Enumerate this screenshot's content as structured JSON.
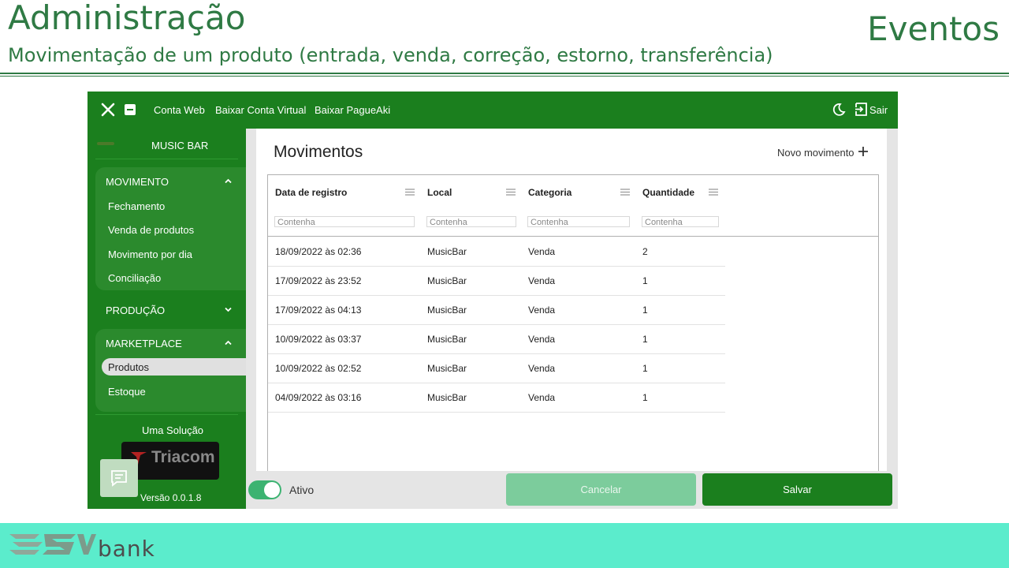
{
  "slide": {
    "title": "Administração",
    "subtitle": "Movimentação de um produto (entrada, venda, correção, estorno, transferência)",
    "tag": "Eventos"
  },
  "topbar": {
    "nav": [
      "Conta Web",
      "Baixar Conta Virtual",
      "Baixar PagueAki"
    ],
    "exit_label": "Sair",
    "color": "#1b7f1e"
  },
  "sidebar": {
    "brand": "MUSIC BAR",
    "groups": [
      {
        "title": "MOVIMENTO",
        "expanded": true,
        "items": [
          "Fechamento",
          "Venda de produtos",
          "Movimento por dia",
          "Conciliação"
        ]
      },
      {
        "title": "PRODUÇÃO",
        "expanded": false,
        "items": []
      },
      {
        "title": "MARKETPLACE",
        "expanded": true,
        "items": [
          "Produtos",
          "Estoque"
        ],
        "active": "Produtos"
      }
    ],
    "solution_label": "Uma Solução",
    "partner_logo": "Triacom",
    "version": "Versão 0.0.1.8"
  },
  "content": {
    "title": "Movimentos",
    "new_button": "Novo movimento",
    "columns": [
      "Data de registro",
      "Local",
      "Categoria",
      "Quantidade"
    ],
    "filter_placeholder": "Contenha",
    "rows": [
      [
        "18/09/2022 às 02:36",
        "MusicBar",
        "Venda",
        "2"
      ],
      [
        "17/09/2022 às 23:52",
        "MusicBar",
        "Venda",
        "1"
      ],
      [
        "17/09/2022 às 04:13",
        "MusicBar",
        "Venda",
        "1"
      ],
      [
        "10/09/2022 às 03:37",
        "MusicBar",
        "Venda",
        "1"
      ],
      [
        "10/09/2022 às 02:52",
        "MusicBar",
        "Venda",
        "1"
      ],
      [
        "04/09/2022 às 03:16",
        "MusicBar",
        "Venda",
        "1"
      ]
    ]
  },
  "bottombar": {
    "toggle_label": "Ativo",
    "toggle_on": true,
    "cancel_label": "Cancelar",
    "save_label": "Salvar"
  },
  "footer": {
    "logo_word": "bank",
    "color": "#5beccc"
  }
}
